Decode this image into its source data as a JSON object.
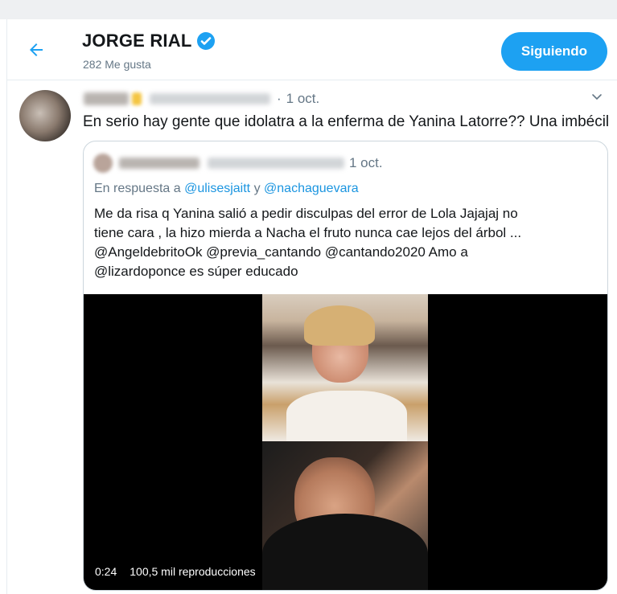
{
  "header": {
    "back_icon": "arrow-left-icon",
    "name": "JORGE RIAL",
    "verified_icon": "verified-badge-icon",
    "likes": "282 Me gusta",
    "follow_label": "Siguiendo",
    "accent": "#1da1f2"
  },
  "tweet": {
    "date": "1 oct.",
    "text": "En serio hay gente que idolatra a la enferma de Yanina Latorre?? Una imbécil",
    "menu_icon": "chevron-down-icon"
  },
  "quoted": {
    "date": "1 oct.",
    "reply_prefix": "En respuesta a",
    "reply_to_1": "@ulisesjaitt",
    "reply_conj": "y",
    "reply_to_2": "@nachaguevara",
    "lines": [
      "Me da risa q Yanina salió a pedir disculpas del  error  de Lola Jajajaj no",
      "tiene cara , la hizo mierda a Nacha el fruto nunca cae lejos del árbol ...",
      "@AngeldebritoOk @previa_cantando @cantando2020 Amo a",
      "@lizardoponce es súper educado"
    ],
    "video": {
      "duration": "0:24",
      "views": "100,5 mil reproducciones"
    }
  }
}
